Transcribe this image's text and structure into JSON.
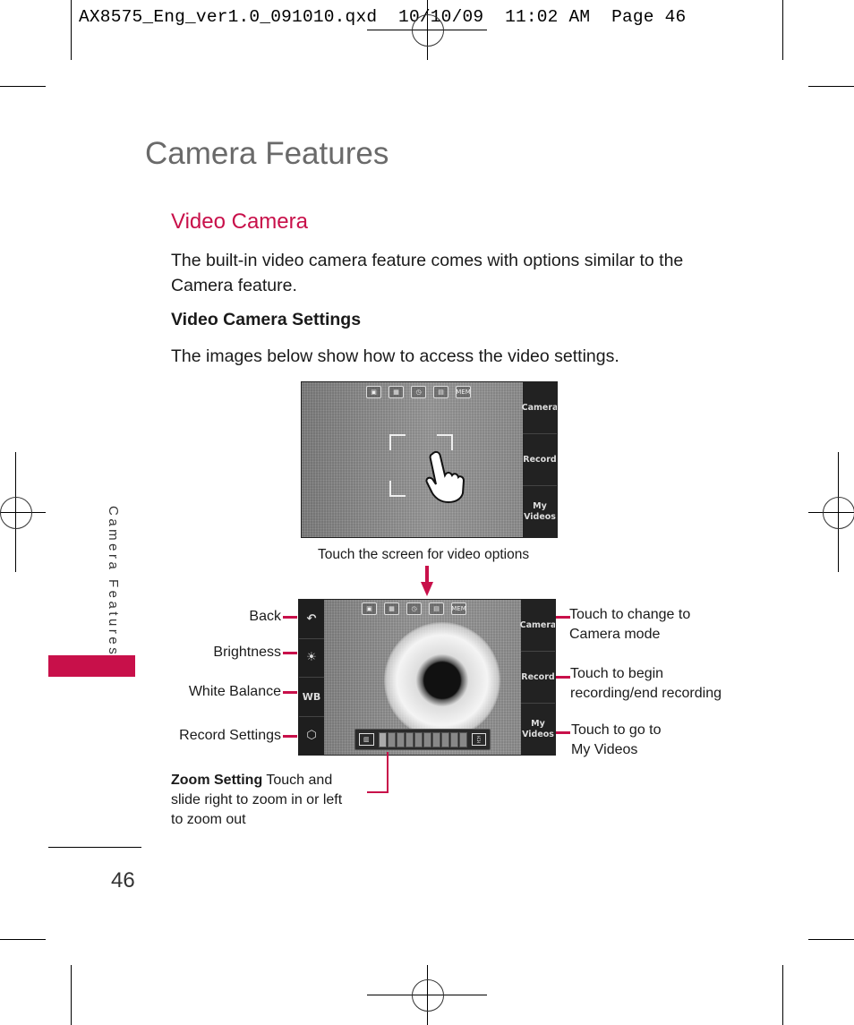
{
  "slug": "AX8575_Eng_ver1.0_091010.qxd  10/10/09  11:02 AM  Page 46",
  "page": {
    "title": "Camera Features",
    "section_heading": "Video Camera",
    "intro": "The built-in video camera feature comes with options similar to the Camera feature.",
    "subheading": "Video Camera Settings",
    "instruction": "The images below show how to access the video settings.",
    "side_tab_text": "Camera Features",
    "page_number": "46",
    "accent_color": "#c8104a"
  },
  "screen1": {
    "top_icons": [
      "video-mode-icon",
      "resolution-icon",
      "timer-icon",
      "storage-icon",
      "memory-icon"
    ],
    "top_icon_glyphs": [
      "▣",
      "▦",
      "◷",
      "▤",
      "MEM"
    ],
    "buttons": [
      "Camera",
      "Record",
      "My Videos"
    ],
    "caption": "Touch the screen for video options"
  },
  "screen2": {
    "top_icon_glyphs": [
      "▣",
      "▦",
      "◷",
      "▤",
      "MEM"
    ],
    "left_buttons": [
      {
        "icon": "back-icon",
        "glyph": "↶"
      },
      {
        "icon": "brightness-icon",
        "glyph": "☀"
      },
      {
        "icon": "white-balance-icon",
        "glyph": "WB"
      },
      {
        "icon": "record-settings-icon",
        "glyph": "⬡"
      }
    ],
    "right_buttons": [
      "Camera",
      "Record",
      "My Videos"
    ],
    "zoom_segments": 10,
    "zoom_level": 0
  },
  "callouts_left": [
    "Back",
    "Brightness",
    "White Balance",
    "Record Settings"
  ],
  "callouts_right": [
    {
      "line1": "Touch to change to",
      "line2": "Camera mode"
    },
    {
      "line1": "Touch to begin",
      "line2": "recording/end recording"
    },
    {
      "line1": "Touch to go to",
      "line2": "My Videos"
    }
  ],
  "zoom_callout": {
    "bold": "Zoom Setting",
    "text": " Touch and",
    "line2": "slide right to zoom in or left",
    "line3": "to zoom out"
  }
}
